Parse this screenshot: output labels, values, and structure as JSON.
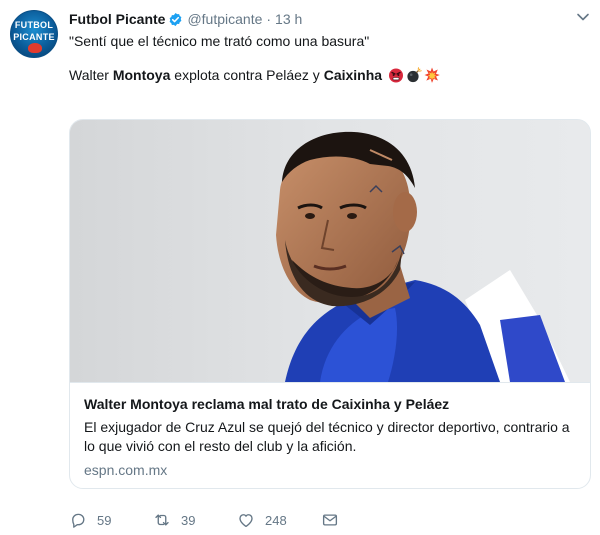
{
  "tweet": {
    "display_name": "Futbol Picante",
    "handle": "@futpicante",
    "separator": "·",
    "time": "13 h",
    "quote": "\"Sentí que el técnico me trató como una basura\"",
    "line2_part1": "Walter ",
    "line2_bold1": "Montoya",
    "line2_part2": " explota contra Peláez y ",
    "line2_bold2": "Caixinha",
    "emojis": [
      "angry-face-icon",
      "bomb-icon",
      "collision-icon"
    ]
  },
  "avatar": {
    "line1": "FUTBOL",
    "line2": "PICANTE"
  },
  "card": {
    "title": "Walter Montoya reclama mal trato de Caixinha y Peláez",
    "description": "El exjugador de Cruz Azul se quejó del técnico y director deportivo, contrario a lo que vivió con el resto del club y la afición.",
    "domain": "espn.com.mx"
  },
  "actions": {
    "reply_count": "59",
    "retweet_count": "39",
    "like_count": "248"
  },
  "colors": {
    "verified": "#1da1f2",
    "secondary_text": "#657786",
    "border": "#e1e8ed",
    "jersey_blue": "#1f3fb5"
  }
}
